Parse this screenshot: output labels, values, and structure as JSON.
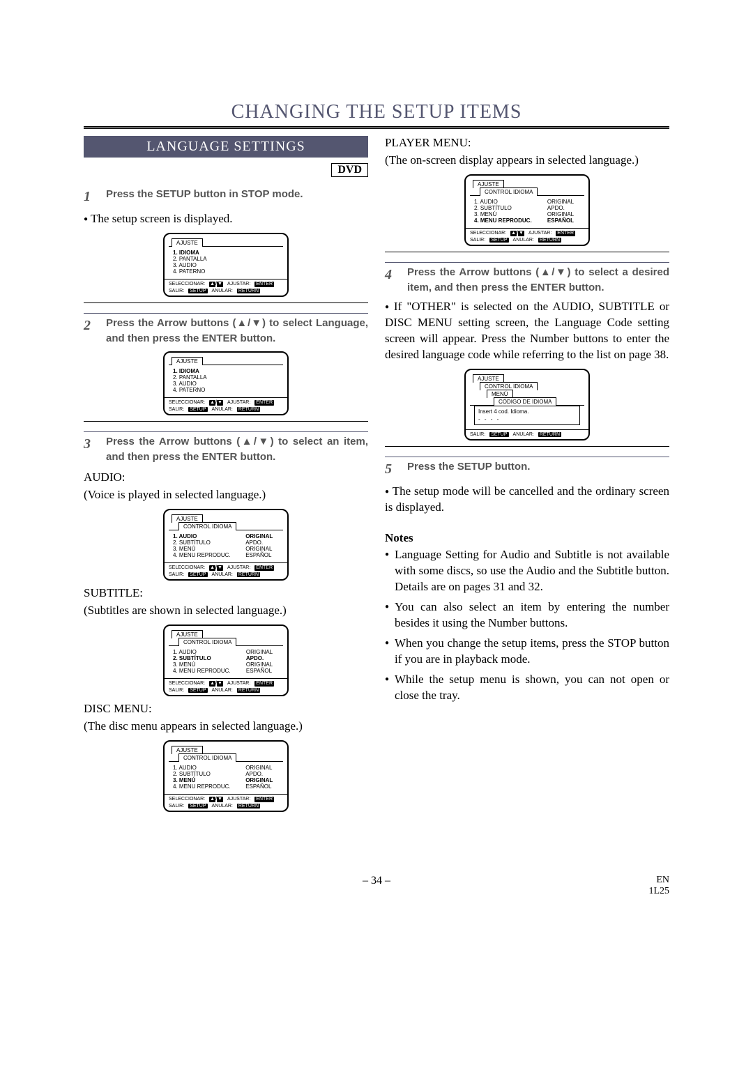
{
  "main_title": "CHANGING THE SETUP ITEMS",
  "section_title": "LANGUAGE SETTINGS",
  "dvd_tag": "DVD",
  "steps": {
    "s1": "Press the SETUP button in STOP mode.",
    "s1_sub": "The setup screen is displayed.",
    "s2": "Press the Arrow buttons (▲/▼) to select Language, and then press the ENTER button.",
    "s3": "Press the Arrow buttons (▲/▼) to select an item, and then press the ENTER button.",
    "s4": "Press the Arrow buttons (▲/▼) to select a desired item, and then press the ENTER button.",
    "s4_sub": "If \"OTHER\" is selected on the AUDIO, SUBTITLE or DISC MENU setting screen, the Language Code setting screen will appear. Press the Number buttons to enter the desired language code while referring to the list on page 38.",
    "s5": "Press the SETUP button.",
    "s5_sub": "The setup mode will be cancelled and the ordinary screen is displayed."
  },
  "headings": {
    "audio_h": "AUDIO:",
    "audio_d": "(Voice is played in selected language.)",
    "subtitle_h": "SUBTITLE:",
    "subtitle_d": "(Subtitles are shown in selected language.)",
    "discmenu_h": "DISC MENU:",
    "discmenu_d": "(The disc menu appears in selected language.)",
    "player_h": "PLAYER MENU:",
    "player_d": "(The on-screen display appears in selected language.)"
  },
  "osd": {
    "ajuste": "AJUSTE",
    "control_idioma": "CONTROL IDIOMA",
    "menu_tab": "MENÚ",
    "codigo_tab": "CÓDIGO DE IDIOMA",
    "main_items": [
      "1. IDIOMA",
      "2. PANTALLA",
      "3. AUDIO",
      "4. PATERNO"
    ],
    "lang_items": [
      {
        "l": "1. AUDIO",
        "r": "ORIGINAL"
      },
      {
        "l": "2. SUBTÍTULO",
        "r": "APDO."
      },
      {
        "l": "3. MENÚ",
        "r": "ORIGINAL"
      },
      {
        "l": "4. MENU REPRODUC.",
        "r": "ESPAÑOL"
      }
    ],
    "code_prompt": "Insert 4 cod. Idioma.",
    "code_dots": "- - - -",
    "footer": {
      "seleccionar": "SELECCIONAR:",
      "ajustar": "AJUSTAR:",
      "enter": "ENTER",
      "salir": "SALIR:",
      "setup": "SETUP",
      "anular": "ANULAR:",
      "return": "RETURN"
    }
  },
  "notes_heading": "Notes",
  "notes": [
    "Language Setting for Audio and Subtitle is not available with some discs, so use the Audio and the Subtitle button. Details are on pages 31 and 32.",
    "You can also select an item by entering the number besides it using the Number buttons.",
    "When you change the setup items, press the STOP button if you are in playback mode.",
    "While the setup menu is shown, you can not open or close the tray."
  ],
  "footer": {
    "page": "– 34 –",
    "code1": "EN",
    "code2": "1L25"
  }
}
